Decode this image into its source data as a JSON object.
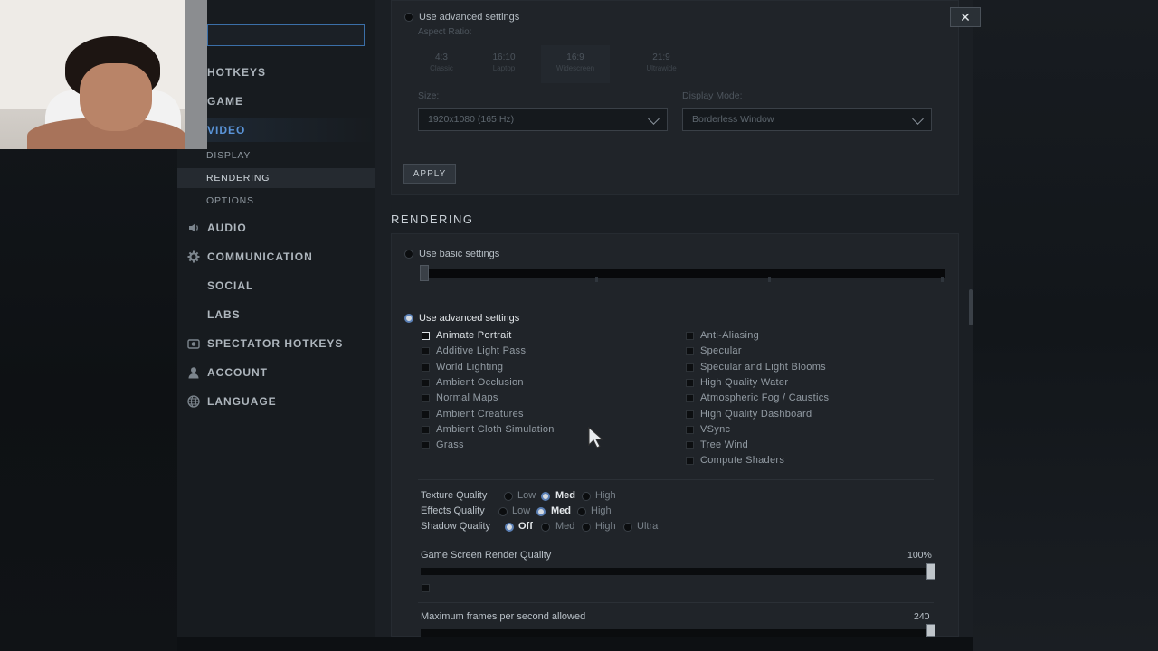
{
  "search": {
    "value": "",
    "placeholder": ""
  },
  "nav": [
    {
      "name": "hotkeys",
      "label": "HOTKEYS",
      "icon": ""
    },
    {
      "name": "game",
      "label": "GAME",
      "icon": ""
    },
    {
      "name": "video",
      "label": "VIDEO",
      "icon": ""
    },
    {
      "name": "audio",
      "label": "AUDIO",
      "icon": "speaker-icon"
    },
    {
      "name": "communication",
      "label": "COMMUNICATION",
      "icon": "gear-icon"
    },
    {
      "name": "social",
      "label": "SOCIAL",
      "icon": ""
    },
    {
      "name": "labs",
      "label": "LABS",
      "icon": ""
    },
    {
      "name": "spectator-hotkeys",
      "label": "SPECTATOR HOTKEYS",
      "icon": "camera-icon"
    },
    {
      "name": "account",
      "label": "ACCOUNT",
      "icon": "user-icon"
    },
    {
      "name": "language",
      "label": "LANGUAGE",
      "icon": "globe-icon"
    }
  ],
  "sub_nav": [
    "DISPLAY",
    "RENDERING",
    "OPTIONS"
  ],
  "display": {
    "advanced_label": "Use advanced settings",
    "aspect_label": "Aspect Ratio:",
    "aspects": [
      {
        "ratio": "4:3",
        "name": "Classic"
      },
      {
        "ratio": "16:10",
        "name": "Laptop"
      },
      {
        "ratio": "16:9",
        "name": "Widescreen"
      },
      {
        "ratio": "21:9",
        "name": "Ultrawide"
      }
    ],
    "size_label": "Size:",
    "size_value": "1920x1080 (165 Hz)",
    "mode_label": "Display Mode:",
    "mode_value": "Borderless Window",
    "apply": "APPLY"
  },
  "rendering": {
    "title": "RENDERING",
    "basic_label": "Use basic settings",
    "advanced_label": "Use advanced settings",
    "left_checks": [
      {
        "label": "Animate Portrait",
        "checked": true
      },
      {
        "label": "Additive Light Pass",
        "checked": false
      },
      {
        "label": "World Lighting",
        "checked": false
      },
      {
        "label": "Ambient Occlusion",
        "checked": false
      },
      {
        "label": "Normal Maps",
        "checked": false
      },
      {
        "label": "Ambient Creatures",
        "checked": false
      },
      {
        "label": "Ambient Cloth Simulation",
        "checked": false
      },
      {
        "label": "Grass",
        "checked": false
      }
    ],
    "right_checks": [
      {
        "label": "Anti-Aliasing",
        "checked": false
      },
      {
        "label": "Specular",
        "checked": false
      },
      {
        "label": "Specular and Light Blooms",
        "checked": false
      },
      {
        "label": "High Quality Water",
        "checked": false
      },
      {
        "label": "Atmospheric Fog / Caustics",
        "checked": false
      },
      {
        "label": "High Quality Dashboard",
        "checked": false
      },
      {
        "label": "VSync",
        "checked": false
      },
      {
        "label": "Tree Wind",
        "checked": false
      },
      {
        "label": "Compute Shaders",
        "checked": false
      }
    ],
    "texture": {
      "label": "Texture Quality",
      "options": [
        "Low",
        "Med",
        "High"
      ],
      "selected": "Med"
    },
    "effects": {
      "label": "Effects Quality",
      "options": [
        "Low",
        "Med",
        "High"
      ],
      "selected": "Med"
    },
    "shadow": {
      "label": "Shadow Quality",
      "options": [
        "Off",
        "Med",
        "High",
        "Ultra"
      ],
      "selected": "Off"
    },
    "render_quality": {
      "label": "Game Screen Render Quality",
      "value_text": "100%",
      "fraction": 1.0
    },
    "max_fps": {
      "label": "Maximum frames per second allowed",
      "value_text": "240",
      "fraction": 1.0
    }
  },
  "close_glyph": "✕"
}
